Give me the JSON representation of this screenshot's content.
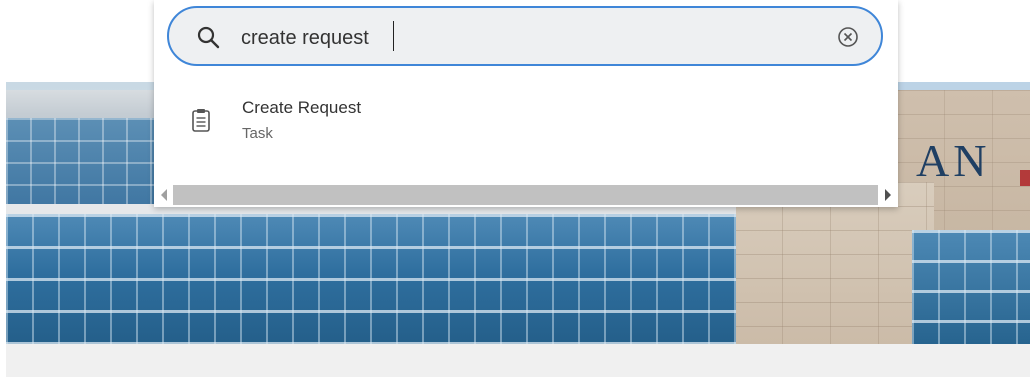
{
  "search": {
    "value": "create request",
    "placeholder": "",
    "accent_color": "#3f86d8"
  },
  "results": [
    {
      "title": "Create Request",
      "type": "Task",
      "icon": "clipboard-icon"
    }
  ],
  "background": {
    "sign_text": "AN"
  },
  "icons": {
    "search": "search-icon",
    "clear": "clear-search-icon",
    "scroll_left": "scroll-left-arrow-icon",
    "scroll_right": "scroll-right-arrow-icon"
  }
}
